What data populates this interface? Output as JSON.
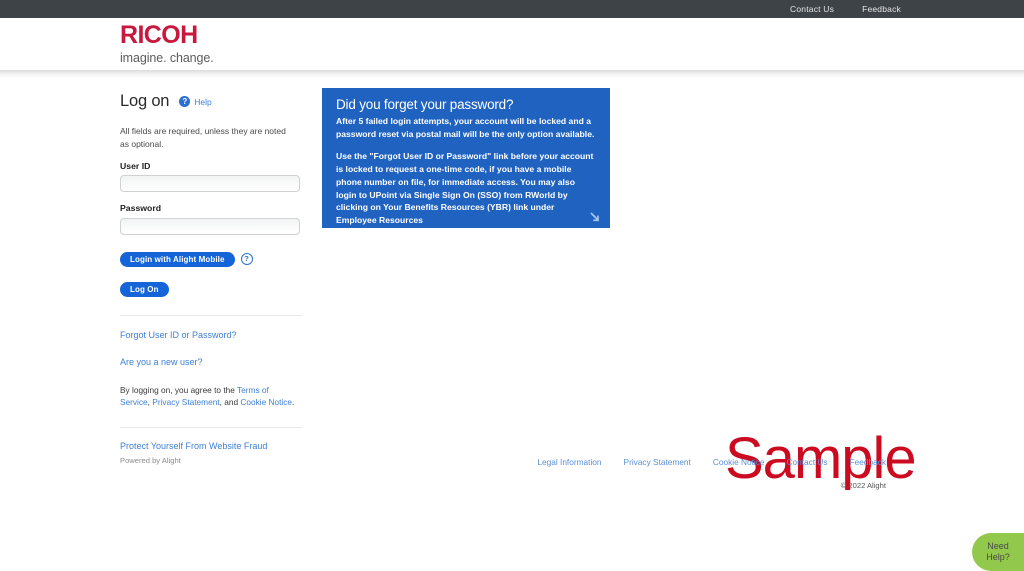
{
  "topbar": {
    "links": [
      {
        "label": "Contact Us"
      },
      {
        "label": "Feedback"
      }
    ]
  },
  "brand": {
    "name": "RICOH",
    "tagline": "imagine. change.",
    "color": "#c9183e"
  },
  "form": {
    "title": "Log on",
    "help_label": "Help",
    "help_icon_glyph": "?",
    "required_note": "All fields are required, unless they are noted as optional.",
    "user_id_label": "User ID",
    "user_id_value": "",
    "user_id_placeholder": "",
    "password_label": "Password",
    "password_value": "",
    "password_placeholder": "",
    "mobile_button_label": "Login with Alight Mobile",
    "mobile_help_glyph": "?",
    "logon_button_label": "Log On",
    "forgot_link": "Forgot User ID or Password?",
    "new_user_link": "Are you a new user?",
    "agree_prefix": "By logging on, you agree to the ",
    "agree_terms": "Terms of Service",
    "agree_sep1": ", ",
    "agree_privacy": "Privacy Statement",
    "agree_sep2": ", and ",
    "agree_cookie": "Cookie Notice",
    "agree_end": ".",
    "fraud_link": "Protect Yourself From Website Fraud",
    "powered_by": "Powered by Alight",
    "button_color": "#1565d8"
  },
  "info_panel": {
    "title": "Did you forget your password?",
    "paragraph1": "After 5 failed login attempts, your account will be locked and a password reset via postal mail will be the only option available.",
    "paragraph2": "Use the \"Forgot User ID or Password\" link before your account is locked to request a one-time code, if you have a mobile phone number on file, for immediate access. You may also login to UPoint via Single Sign On (SSO) from RWorld by clicking on Your Benefits Resources (YBR) link under Employee Resources",
    "background_color": "#2062c0"
  },
  "watermark": {
    "text": "Sample",
    "color": "#cc0a20"
  },
  "footer": {
    "links": [
      {
        "label": "Legal Information"
      },
      {
        "label": "Privacy Statement"
      },
      {
        "label": "Cookie Notice"
      },
      {
        "label": "Contact Us"
      },
      {
        "label": "Feedback"
      }
    ],
    "copyright": "© 2022 Alight"
  },
  "need_help": {
    "line1": "Need",
    "line2": "Help?",
    "color": "#92c84b"
  }
}
